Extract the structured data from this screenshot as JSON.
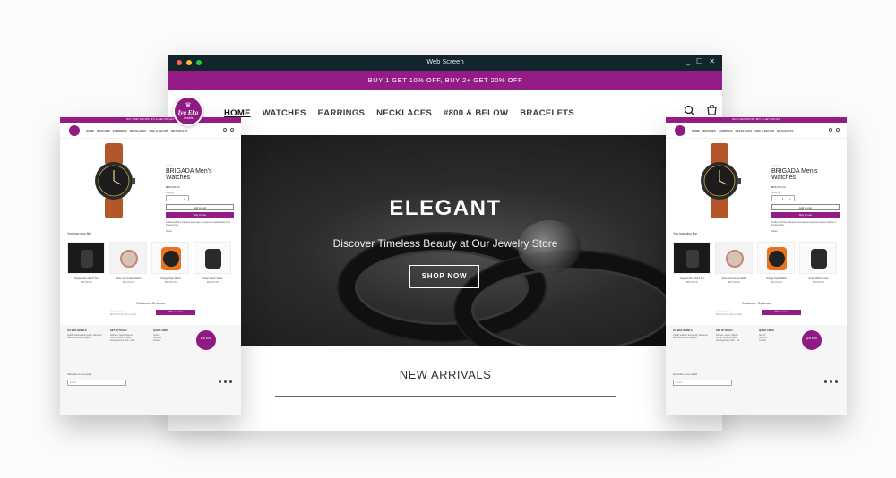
{
  "window": {
    "title": "Web Screen",
    "minimize": "_",
    "maximize": "☐",
    "close": "✕"
  },
  "promo": "BUY 1 GET 10% OFF, BUY 2+ GET 20% OFF",
  "logo": {
    "name": "Iya Eko",
    "sub": "Jewels",
    "crown": "♛"
  },
  "nav": [
    "HOME",
    "WATCHES",
    "EARRINGS",
    "NECKLACES",
    "#800 & BELOW",
    "BRACELETS"
  ],
  "hero": {
    "title": "ELEGANT",
    "subtitle": "Discover Timeless Beauty at Our Jewelry Store",
    "button": "SHOP NOW"
  },
  "section_title": "NEW ARRIVALS",
  "mock": {
    "promo": "BUY 1 GET 10% OFF, BUY 2+ GET 20% OFF",
    "nav": [
      "HOME",
      "WATCHES",
      "EARRINGS",
      "NECKLACES",
      "#800 & BELOW",
      "BRACELETS"
    ],
    "brand": "Iya Eko",
    "product_title": "BRIGADA Men's Watches",
    "price": "₦45,000.00",
    "qty_label": "Quantity",
    "qty": {
      "minus": "-",
      "value": "1",
      "plus": "+"
    },
    "add_to_cart": "Add to cart",
    "buy_now": "Buy it now",
    "description": "Crafted with fine stainless steel case and genuine leather strap for a timeless look.",
    "share": "Share",
    "like_title": "You may also like",
    "cards": [
      {
        "name": "Elegant Men Watch Set",
        "price": "₦38,000.00"
      },
      {
        "name": "Rose Gold Ladies Watch",
        "price": "₦42,000.00"
      },
      {
        "name": "Orange Sport Watch",
        "price": "₦35,000.00"
      },
      {
        "name": "Smart Watch Series",
        "price": "₦29,000.00"
      }
    ],
    "reviews_title": "Customer Reviews",
    "stars": "☆☆☆☆☆",
    "reviews_text": "Be the first to write a review",
    "write_review": "Write a review",
    "footer": {
      "col1": {
        "title": "IYA EKO JEWELS",
        "text": "Quality watches and jewelry delivered nationwide across Nigeria."
      },
      "col2": {
        "title": "GET IN TOUCH",
        "address": "Address: Lagos, Nigeria",
        "phone": "Phone: 0800 000 0000",
        "opening": "Opening hours: Mon - Sat"
      },
      "col3": {
        "title": "QUICK LINKS",
        "links": [
          "Search",
          "About us",
          "Contact"
        ]
      },
      "subscribe": "Subscribe to our emails",
      "email_placeholder": "Email"
    }
  }
}
